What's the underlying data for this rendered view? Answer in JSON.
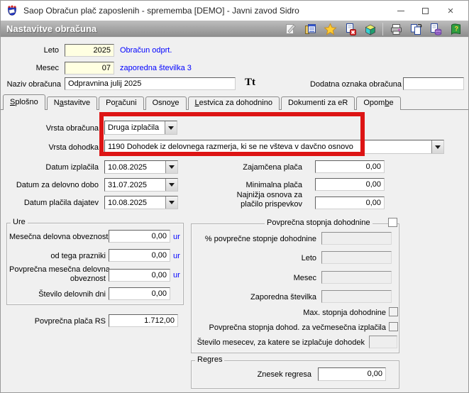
{
  "window": {
    "title": "Saop Obračun plač zaposlenih - sprememba [DEMO] - Javni zavod Sidro"
  },
  "header": {
    "title": "Nastavitve obračuna",
    "toolbar_icons": [
      "edit-note",
      "journal",
      "favorite-star",
      "delete-document",
      "cube",
      "print",
      "copy-structure",
      "copy-data",
      "help-book"
    ]
  },
  "top": {
    "leto": {
      "label": "Leto",
      "value": "2025",
      "status": "Obračun odprt."
    },
    "mesec": {
      "label": "Mesec",
      "value": "07",
      "status": "zaporedna številka 3"
    },
    "naziv": {
      "label": "Naziv obračuna",
      "value": "Odpravnina julij 2025"
    },
    "font_icon": "Tt",
    "dodatna": {
      "label": "Dodatna oznaka obračuna",
      "value": ""
    }
  },
  "tabs": [
    {
      "pre": "",
      "key": "S",
      "post": "plošno",
      "active": true
    },
    {
      "pre": "N",
      "key": "a",
      "post": "stavitve"
    },
    {
      "pre": "Po",
      "key": "r",
      "post": "ačuni"
    },
    {
      "pre": "Osno",
      "key": "v",
      "post": "e"
    },
    {
      "pre": "",
      "key": "L",
      "post": "estvica za dohodnino"
    },
    {
      "pre": "Dokumenti za eR",
      "key": "",
      "post": ""
    },
    {
      "pre": "Opom",
      "key": "b",
      "post": "e"
    }
  ],
  "form": {
    "vrsta_obracuna": {
      "label": "Vrsta obračuna",
      "value": "Druga izplačila"
    },
    "vrsta_dohodka": {
      "label": "Vrsta dohodka",
      "value": "1190  Dohodek iz delovnega razmerja, ki se ne všteva v davčno osnovo"
    },
    "datum_izplacila": {
      "label": "Datum izplačila",
      "value": "10.08.2025"
    },
    "datum_za_delovno_dobo": {
      "label": "Datum za delovno dobo",
      "value": "31.07.2025"
    },
    "datum_placila_dajatev": {
      "label": "Datum plačila dajatev",
      "value": "10.08.2025"
    },
    "zajamcena_placa": {
      "label": "Zajamčena plača",
      "value": "0,00"
    },
    "minimalna_placa": {
      "label": "Minimalna plača",
      "value": "0,00"
    },
    "najnizja_osnova": {
      "label_line1": "Najnižja osnova za",
      "label_line2": "plačilo prispevkov",
      "value": "0,00"
    }
  },
  "ure": {
    "title": "Ure",
    "mesecna": {
      "label": "Mesečna delovna obveznost",
      "value": "0,00",
      "unit": "ur"
    },
    "prazniki": {
      "label": "od tega prazniki",
      "value": "0,00",
      "unit": "ur"
    },
    "povprecna": {
      "label_line1": "Povprečna mesečna delovna",
      "label_line2": "obveznost",
      "value": "0,00",
      "unit": "ur"
    },
    "delovni_dnevi": {
      "label": "Število delovnih dni",
      "value": "0,00"
    }
  },
  "povprecna_placa_rs": {
    "label": "Povprečna plača RS",
    "value": "1.712,00"
  },
  "dohodnina": {
    "title": "Povprečna stopnja dohodnine",
    "checkbox_checked": false,
    "procent": {
      "label": "% povprečne stopnje dohodnine",
      "value": ""
    },
    "leto": {
      "label": "Leto",
      "value": ""
    },
    "mesec": {
      "label": "Mesec",
      "value": ""
    },
    "zaporedna": {
      "label": "Zaporedna številka",
      "value": ""
    },
    "max": {
      "label": "Max. stopnja dohodnine",
      "checked": false
    },
    "vecmesecna": {
      "label": "Povprečna stopnja dohod. za večmesečna izplačila",
      "checked": false
    },
    "st_mesecev": {
      "label": "Število mesecev, za katere se izplačuje dohodek",
      "value": ""
    }
  },
  "regres": {
    "title": "Regres",
    "znesek": {
      "label": "Znesek regresa",
      "value": "0,00"
    }
  },
  "colors": {
    "accent_blue": "#0000ff",
    "annotation_red": "#dd1414",
    "field_cream": "#ffffe1"
  }
}
